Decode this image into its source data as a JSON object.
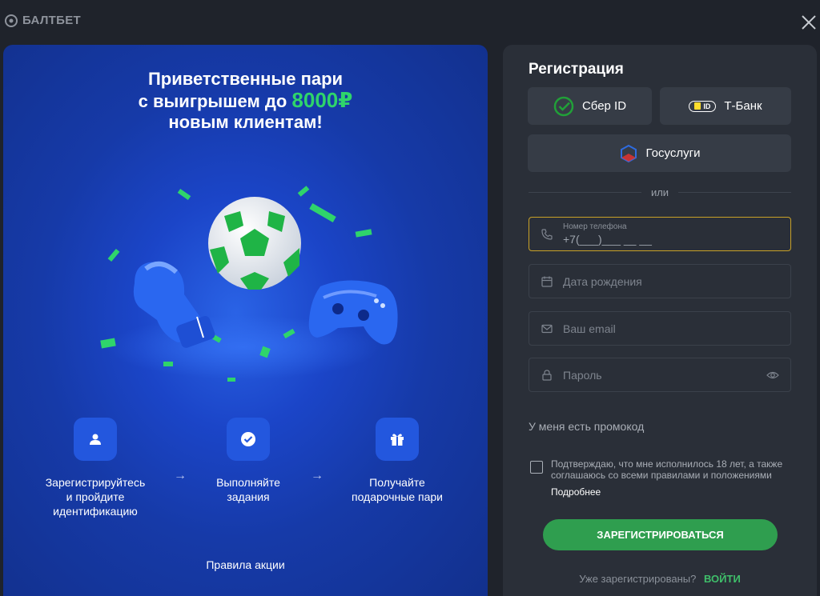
{
  "brand": {
    "name": "БАЛТБЕТ"
  },
  "promo": {
    "title_line1": "Приветственные пари",
    "title_line2_prefix": "с выигрышем до",
    "title_line2_amount": "8000₽",
    "title_line3": "новым клиентам!",
    "steps": [
      {
        "icon": "user-icon",
        "text": "Зарегистрируйтесь\nи пройдите\nидентификацию"
      },
      {
        "icon": "check-icon",
        "text": "Выполняйте\nзадания"
      },
      {
        "icon": "gift-icon",
        "text": "Получайте\nподарочные пари"
      }
    ],
    "arrow": "→",
    "rules_link": "Правила акции"
  },
  "registration": {
    "title": "Регистрация",
    "sber_label": "Сбер ID",
    "tbank_label": "Т-Банк",
    "tbank_badge": "ID",
    "gosuslugi_label": "Госуслуги",
    "divider_text": "или",
    "phone": {
      "label": "Номер телефона",
      "value": "+7(___)___ __ __"
    },
    "birthdate_placeholder": "Дата рождения",
    "email_placeholder": "Ваш email",
    "password_placeholder": "Пароль",
    "promo_code_toggle": "У меня есть промокод",
    "consent_text": "Подтверждаю, что мне исполнилось 18 лет, а также соглашаюсь со всеми правилами и положениями",
    "more_link": "Подробнее",
    "submit_label": "ЗАРЕГИСТРИРОВАТЬСЯ",
    "already_registered": "Уже зарегистрированы?",
    "login_link": "ВОЙТИ"
  },
  "colors": {
    "accent_green": "#2fd46b",
    "submit_green": "#2f9e4f",
    "panel_blue": "#1b45c8",
    "active_border": "#c9a227"
  }
}
